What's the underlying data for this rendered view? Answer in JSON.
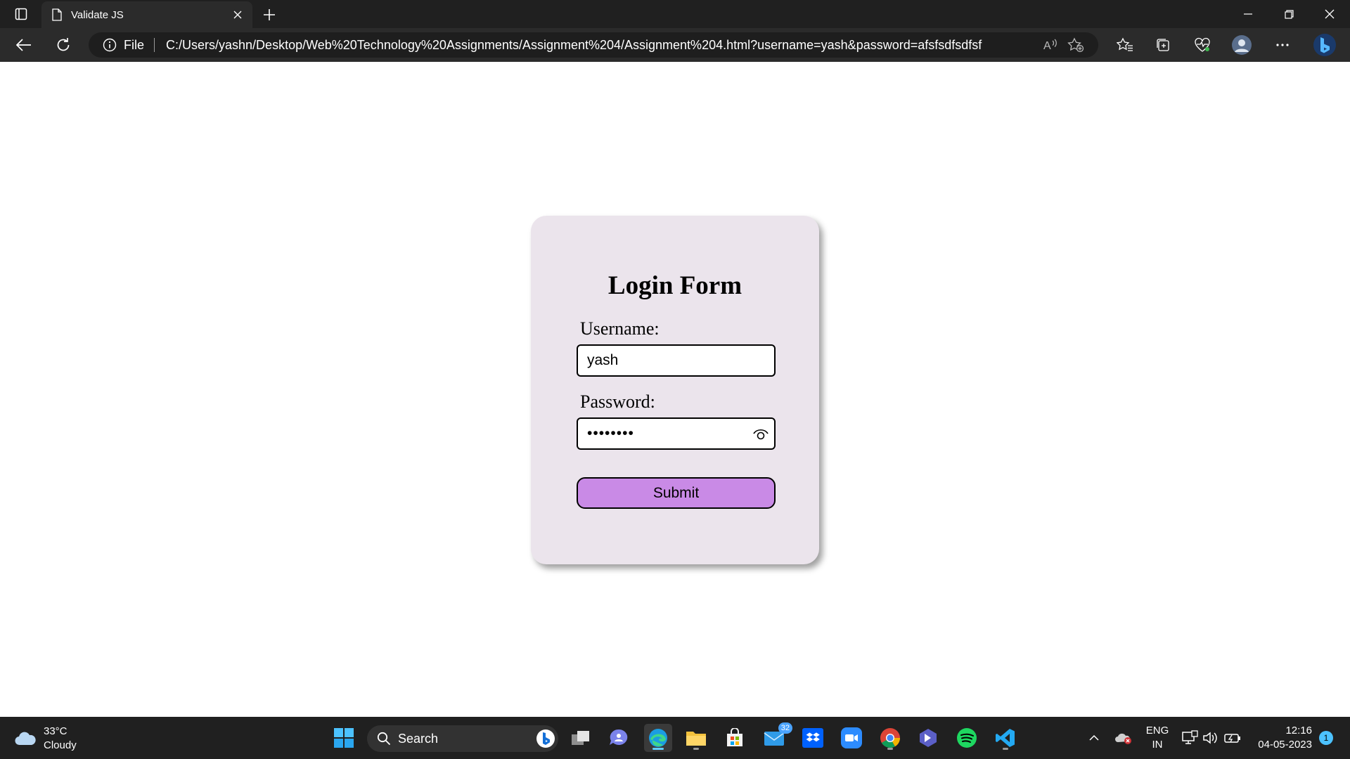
{
  "browser": {
    "tab_title": "Validate JS",
    "address_prefix": "File",
    "url": "C:/Users/yashn/Desktop/Web%20Technology%20Assignments/Assignment%204/Assignment%204.html?username=yash&password=afsfsdfsdfsf"
  },
  "form": {
    "title": "Login Form",
    "username_label": "Username:",
    "username_value": "yash",
    "password_label": "Password:",
    "password_value": "••••••••",
    "submit_label": "Submit"
  },
  "taskbar": {
    "weather_temp": "33°C",
    "weather_desc": "Cloudy",
    "search_placeholder": "Search",
    "mail_badge": "32",
    "lang_top": "ENG",
    "lang_bottom": "IN",
    "time": "12:16",
    "date": "04-05-2023",
    "notification_count": "1"
  }
}
